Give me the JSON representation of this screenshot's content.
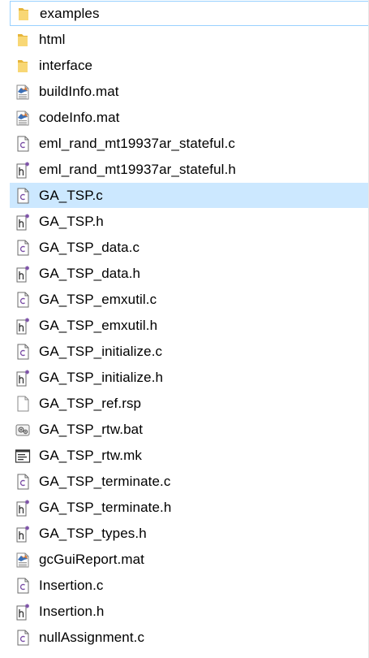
{
  "files": [
    {
      "name": "examples",
      "type": "folder",
      "focused": true
    },
    {
      "name": "html",
      "type": "folder"
    },
    {
      "name": "interface",
      "type": "folder"
    },
    {
      "name": "buildInfo.mat",
      "type": "mat"
    },
    {
      "name": "codeInfo.mat",
      "type": "mat"
    },
    {
      "name": "eml_rand_mt19937ar_stateful.c",
      "type": "c"
    },
    {
      "name": "eml_rand_mt19937ar_stateful.h",
      "type": "h"
    },
    {
      "name": "GA_TSP.c",
      "type": "c",
      "selected": true
    },
    {
      "name": "GA_TSP.h",
      "type": "h"
    },
    {
      "name": "GA_TSP_data.c",
      "type": "c"
    },
    {
      "name": "GA_TSP_data.h",
      "type": "h"
    },
    {
      "name": "GA_TSP_emxutil.c",
      "type": "c"
    },
    {
      "name": "GA_TSP_emxutil.h",
      "type": "h"
    },
    {
      "name": "GA_TSP_initialize.c",
      "type": "c"
    },
    {
      "name": "GA_TSP_initialize.h",
      "type": "h"
    },
    {
      "name": "GA_TSP_ref.rsp",
      "type": "blank"
    },
    {
      "name": "GA_TSP_rtw.bat",
      "type": "bat"
    },
    {
      "name": "GA_TSP_rtw.mk",
      "type": "mk"
    },
    {
      "name": "GA_TSP_terminate.c",
      "type": "c"
    },
    {
      "name": "GA_TSP_terminate.h",
      "type": "h"
    },
    {
      "name": "GA_TSP_types.h",
      "type": "h"
    },
    {
      "name": "gcGuiReport.mat",
      "type": "mat"
    },
    {
      "name": "Insertion.c",
      "type": "c"
    },
    {
      "name": "Insertion.h",
      "type": "h"
    },
    {
      "name": "nullAssignment.c",
      "type": "c"
    }
  ],
  "icons": {
    "folder": "folder-icon",
    "mat": "matlab-data-file-icon",
    "c": "c-source-file-icon",
    "h": "c-header-file-icon",
    "blank": "blank-file-icon",
    "bat": "batch-file-icon",
    "mk": "makefile-icon"
  },
  "colors": {
    "selection": "#cce8ff",
    "focus_border": "#99d1ff",
    "folder": "#f8d775",
    "folder_dark": "#e6b53a",
    "file_accent": "#7b4fa6"
  }
}
